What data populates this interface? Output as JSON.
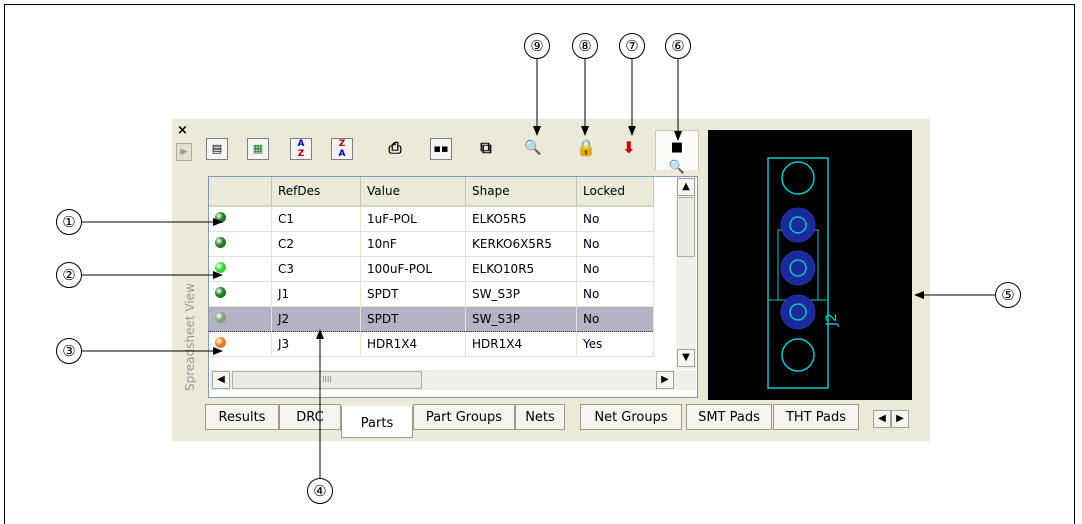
{
  "sidebar": {
    "close_glyph": "×",
    "arrow_glyph": "▶",
    "label": "Spreadsheet View"
  },
  "toolbar": {
    "icons": [
      "save-icon",
      "excel-export-icon",
      "sort-ascending-icon",
      "sort-descending-icon",
      "print-icon",
      "columns-icon",
      "copy-icon",
      "find-icon",
      "lock-icon",
      "apply-icon",
      "zoom-view-icon"
    ]
  },
  "grid": {
    "columns": [
      "",
      "RefDes",
      "Value",
      "Shape",
      "Locked"
    ],
    "rows": [
      {
        "status": "#1f7a1f",
        "refdes": "C1",
        "value": "1uF-POL",
        "shape": "ELKO5R5",
        "locked": "No"
      },
      {
        "status": "#1f7a1f",
        "refdes": "C2",
        "value": "10nF",
        "shape": "KERKO6X5R5",
        "locked": "No"
      },
      {
        "status": "#34d334",
        "refdes": "C3",
        "value": "100uF-POL",
        "shape": "ELKO10R5",
        "locked": "No"
      },
      {
        "status": "#1f7a1f",
        "refdes": "J1",
        "value": "SPDT",
        "shape": "SW_S3P",
        "locked": "No"
      },
      {
        "status": "#7fa07f",
        "refdes": "J2",
        "value": "SPDT",
        "shape": "SW_S3P",
        "locked": "No"
      },
      {
        "status": "#f07a1a",
        "refdes": "J3",
        "value": "HDR1X4",
        "shape": "HDR1X4",
        "locked": "Yes"
      }
    ]
  },
  "tabs": [
    "Results",
    "DRC",
    "Parts",
    "Part Groups",
    "Nets",
    "Net Groups",
    "SMT Pads",
    "THT Pads"
  ],
  "tab_nav": {
    "left": "◀",
    "right": "▶"
  },
  "scroll": {
    "up": "▲",
    "down": "▼",
    "left": "◀",
    "right": "▶",
    "grip": "IIII"
  },
  "pcb": {
    "label": "J2",
    "outline_color": "#00c8d0",
    "pad_color": "#1a2a9a"
  },
  "callouts": [
    "①",
    "②",
    "③",
    "④",
    "⑤",
    "⑥",
    "⑦",
    "⑧",
    "⑨"
  ]
}
